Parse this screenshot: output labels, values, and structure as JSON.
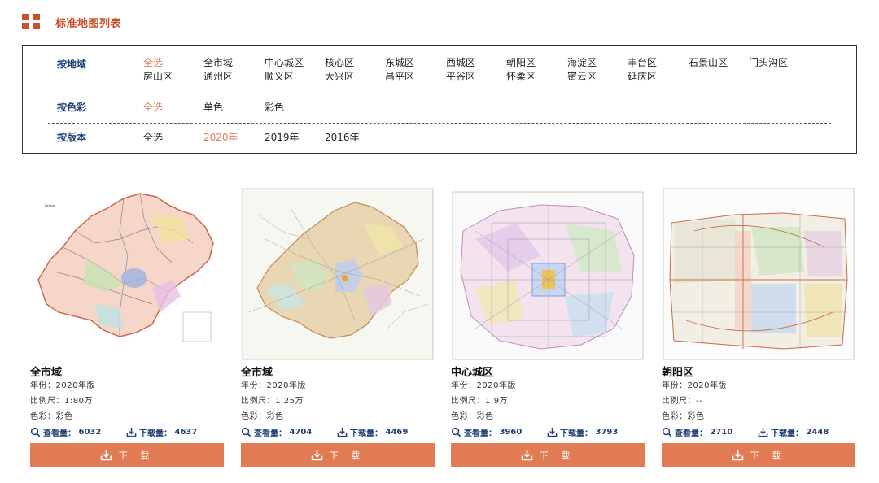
{
  "header": {
    "title": "标准地图列表",
    "accent": "#c9502a"
  },
  "filters": {
    "region": {
      "label": "按地域",
      "options": [
        "全选",
        "全市域",
        "中心城区",
        "核心区",
        "东城区",
        "西城区",
        "朝阳区",
        "海淀区",
        "丰台区",
        "石景山区",
        "门头沟区",
        "房山区",
        "通州区",
        "顺义区",
        "大兴区",
        "昌平区",
        "平谷区",
        "怀柔区",
        "密云区",
        "延庆区"
      ],
      "selected": "全选"
    },
    "color": {
      "label": "按色彩",
      "options": [
        "全选",
        "单色",
        "彩色"
      ],
      "selected": "全选"
    },
    "edition": {
      "label": "按版本",
      "options": [
        "全选",
        "2020年",
        "2019年",
        "2016年"
      ],
      "selected": "2020年"
    }
  },
  "cards": [
    {
      "title": "全市域",
      "year": "年份：2020年版",
      "scale": "比例尺：1:80万",
      "color": "色彩：彩色",
      "views_label": "查看量：",
      "views": "6032",
      "downloads_label": "下载量：",
      "downloads": "4637",
      "button": "下 载"
    },
    {
      "title": "全市域",
      "year": "年份：2020年版",
      "scale": "比例尺：1:25万",
      "color": "色彩：彩色",
      "views_label": "查看量：",
      "views": "4704",
      "downloads_label": "下载量：",
      "downloads": "4469",
      "button": "下 载"
    },
    {
      "title": "中心城区",
      "year": "年份：2020年版",
      "scale": "比例尺：1:9万",
      "color": "色彩：彩色",
      "views_label": "查看量：",
      "views": "3960",
      "downloads_label": "下载量：",
      "downloads": "3793",
      "button": "下 载"
    },
    {
      "title": "朝阳区",
      "year": "年份：2020年版",
      "scale": "比例尺：--",
      "color": "色彩：彩色",
      "views_label": "查看量：",
      "views": "2710",
      "downloads_label": "下载量：",
      "downloads": "2448",
      "button": "下 载"
    }
  ],
  "colors": {
    "accent": "#e07b54",
    "label_blue": "#1f3f78",
    "active_option": "#e07b54"
  },
  "icons": {
    "view": "magnifier-icon",
    "download": "download-tray-icon",
    "header": "grid-icon"
  }
}
